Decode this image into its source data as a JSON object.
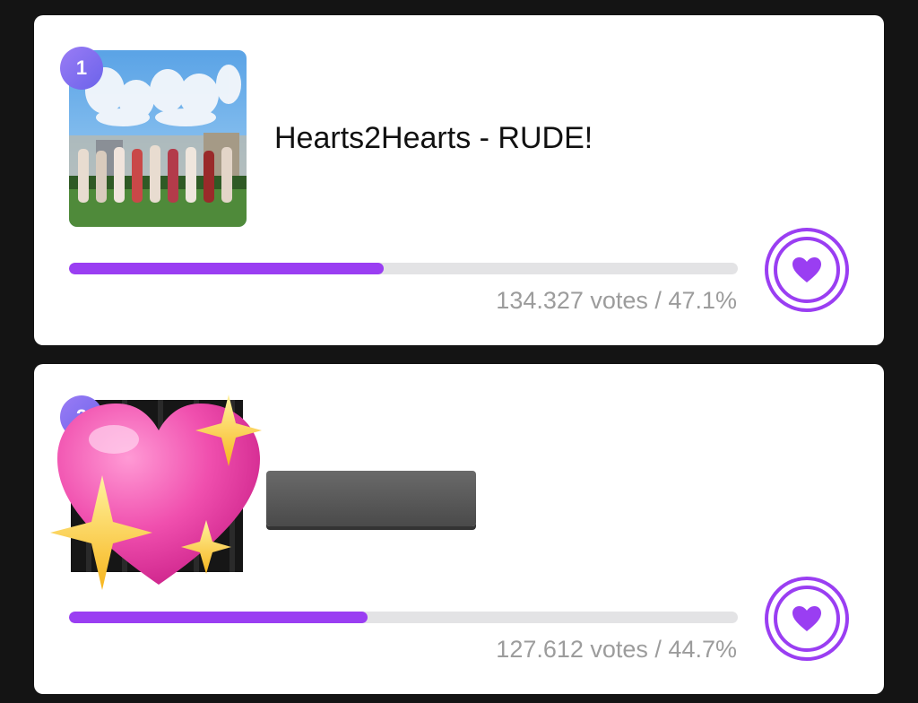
{
  "entries": [
    {
      "rank": "1",
      "title": "Hearts2Hearts - RUDE!",
      "votes_text": "134.327 votes / 47.1%",
      "percent": 47.1,
      "thumbnail_icon": "album-cover-image",
      "vote_button_icon": "heart-icon"
    },
    {
      "rank": "2",
      "title": "",
      "votes_text": "127.612 votes / 44.7%",
      "percent": 44.7,
      "thumbnail_icon": "album-cover-image",
      "overlay_icon": "sparkling-heart-emoji",
      "vote_button_icon": "heart-icon"
    }
  ],
  "colors": {
    "accent": "#9a3ef2",
    "rank_badge": "#7b68ee",
    "track": "#e3e3e5",
    "background": "#141414"
  }
}
